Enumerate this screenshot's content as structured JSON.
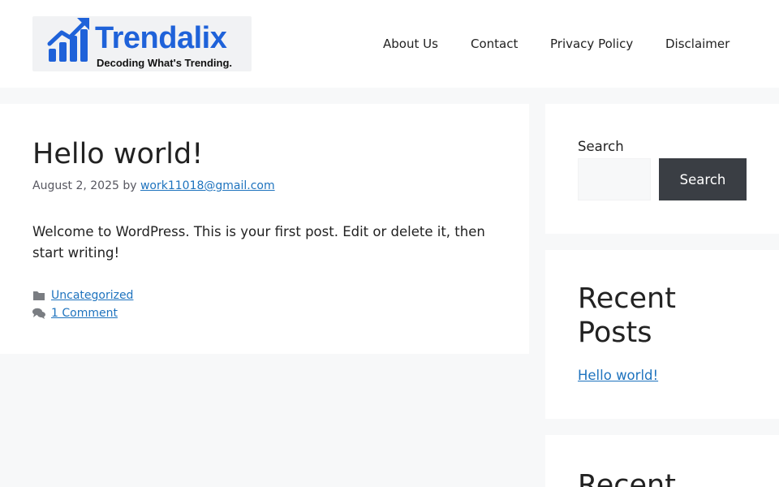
{
  "header": {
    "logo": {
      "name": "Trendalix",
      "tagline": "Decoding What's Trending.",
      "brand_color": "#1f62d9"
    },
    "nav": [
      "About Us",
      "Contact",
      "Privacy Policy",
      "Disclaimer"
    ]
  },
  "post": {
    "title": "Hello world!",
    "date": "August 2, 2025",
    "by": "by",
    "author": "work11018@gmail.com",
    "content": "Welcome to WordPress. This is your first post. Edit or delete it, then start writing!",
    "category": "Uncategorized",
    "comments": "1 Comment"
  },
  "sidebar": {
    "search_label": "Search",
    "search_value": "",
    "search_button": "Search",
    "recent_posts_title": "Recent Posts",
    "recent_posts": [
      "Hello world!"
    ],
    "next_widget_title": "Recent"
  },
  "colors": {
    "link": "#1e73be",
    "button": "#3a3e44",
    "background": "#f7f8f9"
  }
}
